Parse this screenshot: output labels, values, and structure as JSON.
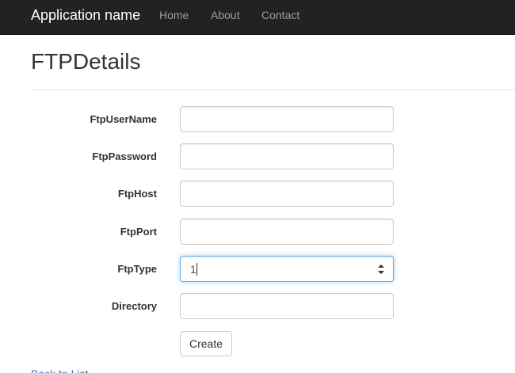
{
  "navbar": {
    "brand": "Application name",
    "links": [
      "Home",
      "About",
      "Contact"
    ]
  },
  "page": {
    "title": "FTPDetails"
  },
  "form": {
    "fields": [
      {
        "label": "FtpUserName",
        "value": "",
        "type": "text"
      },
      {
        "label": "FtpPassword",
        "value": "",
        "type": "text"
      },
      {
        "label": "FtpHost",
        "value": "",
        "type": "text"
      },
      {
        "label": "FtpPort",
        "value": "",
        "type": "text"
      },
      {
        "label": "FtpType",
        "value": "1",
        "type": "number",
        "focused": true
      },
      {
        "label": "Directory",
        "value": "",
        "type": "text"
      }
    ],
    "submit_label": "Create"
  },
  "footer": {
    "back_link": "Back to List"
  },
  "colors": {
    "navbar_bg": "#222222",
    "link_blue": "#337ab7",
    "focus_border": "#66afe9"
  }
}
